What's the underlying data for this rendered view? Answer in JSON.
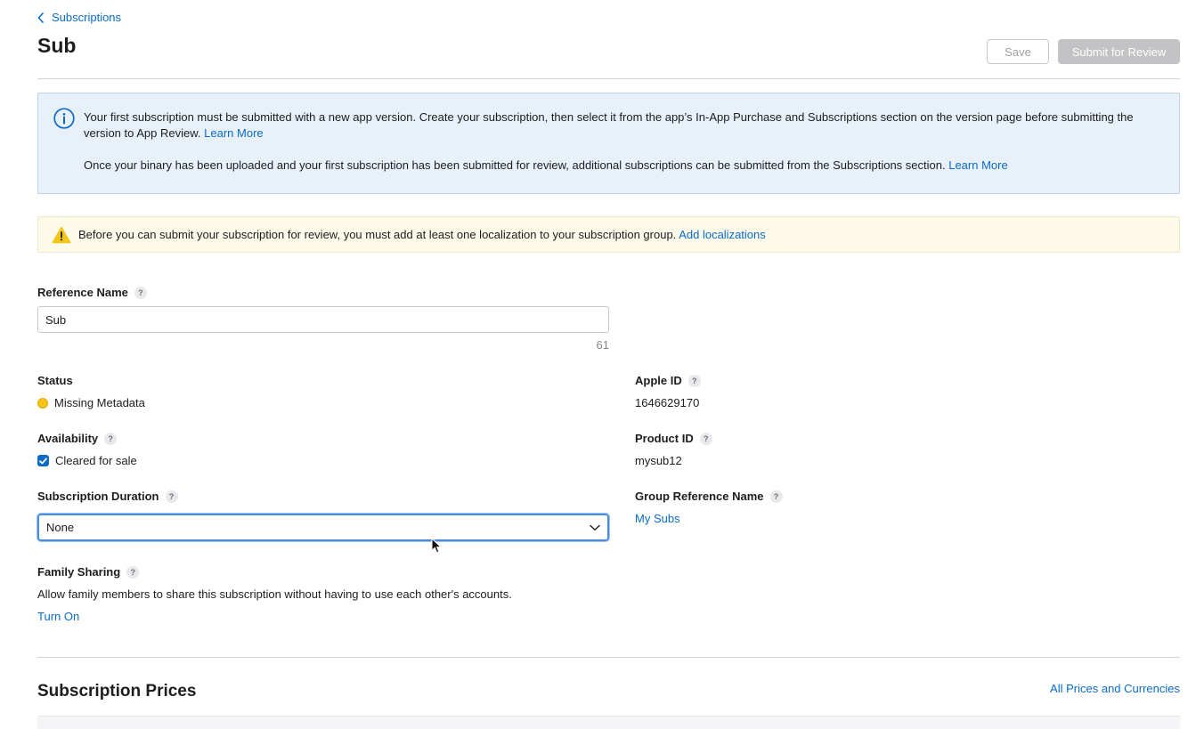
{
  "header": {
    "breadcrumb": "Subscriptions",
    "title": "Sub",
    "save_label": "Save",
    "submit_label": "Submit for Review"
  },
  "info_banner": {
    "p1_text": "Your first subscription must be submitted with a new app version. Create your subscription, then select it from the app’s In-App Purchase and Subscriptions section on the version page before submitting the version to App Review.",
    "p1_link": "Learn More",
    "p2_text": "Once your binary has been uploaded and your first subscription has been submitted for review, additional subscriptions can be submitted from the Subscriptions section.",
    "p2_link": "Learn More"
  },
  "warning_banner": {
    "text": "Before you can submit your subscription for review, you must add at least one localization to your subscription group.",
    "link": "Add localizations"
  },
  "form": {
    "reference_name": {
      "label": "Reference Name",
      "value": "Sub",
      "char_count": "61"
    },
    "status": {
      "label": "Status",
      "value": "Missing Metadata",
      "color": "#f5c518"
    },
    "availability": {
      "label": "Availability",
      "checkbox_label": "Cleared for sale",
      "checked": true
    },
    "duration": {
      "label": "Subscription Duration",
      "selected": "None"
    },
    "family_sharing": {
      "label": "Family Sharing",
      "description": "Allow family members to share this subscription without having to use each other's accounts.",
      "action": "Turn On"
    },
    "apple_id": {
      "label": "Apple ID",
      "value": "1646629170"
    },
    "product_id": {
      "label": "Product ID",
      "value": "mysub12"
    },
    "group_reference": {
      "label": "Group Reference Name",
      "value": "My Subs"
    }
  },
  "prices": {
    "title": "Subscription Prices",
    "link": "All Prices and Currencies"
  },
  "colors": {
    "accent": "#0a6bc9",
    "info_bg": "#e8f1fa",
    "warning_bg": "#fdfaea",
    "warning_icon": "#f5c518"
  },
  "icons": [
    "chevron-left-icon",
    "info-icon",
    "warning-icon",
    "help-icon",
    "check-icon",
    "chevron-down-icon",
    "cursor-icon"
  ]
}
